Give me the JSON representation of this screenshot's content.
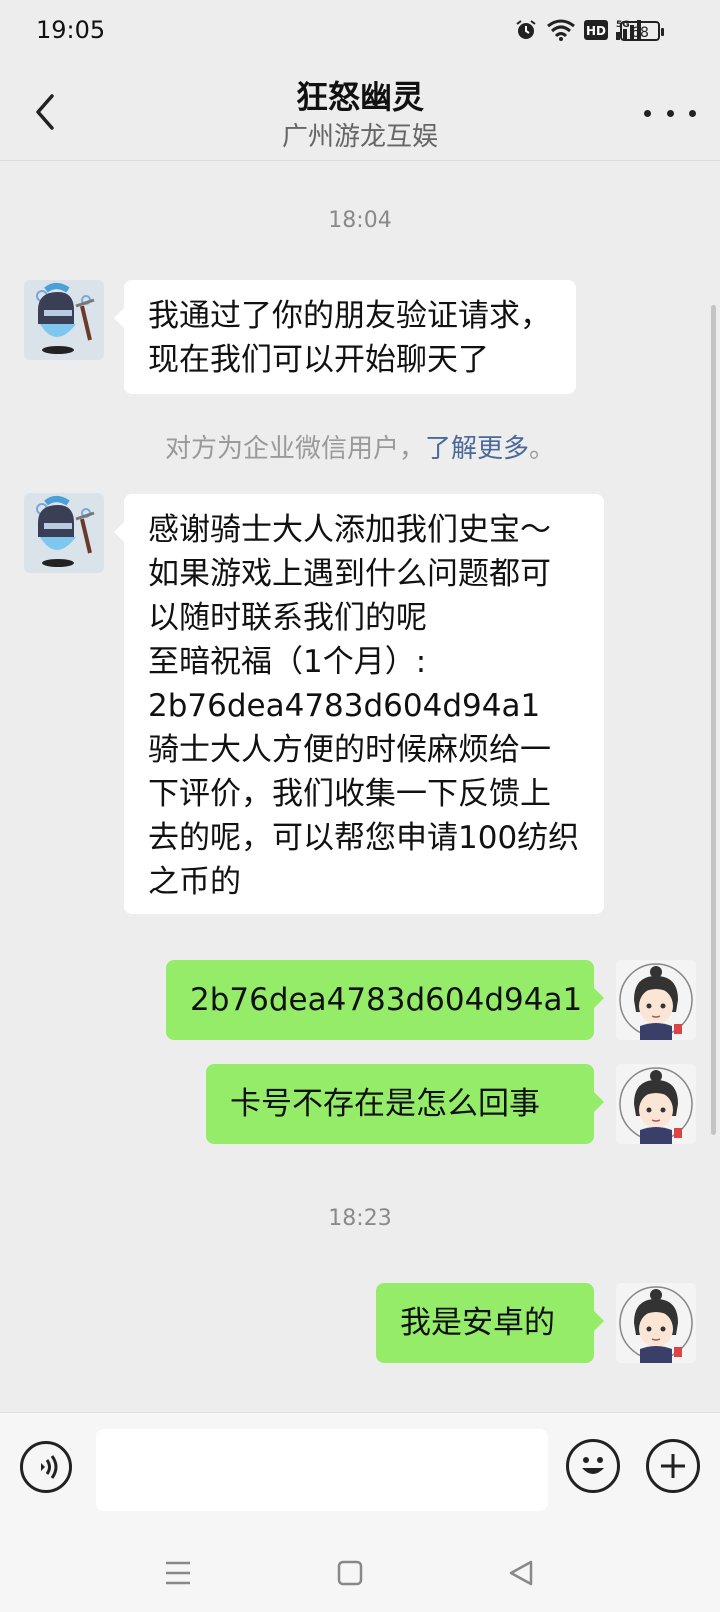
{
  "status_bar": {
    "time": "19:05",
    "battery": "68",
    "icons": [
      "alarm-icon",
      "wifi-icon",
      "hd-icon",
      "signal-5g-icon",
      "battery-icon"
    ]
  },
  "header": {
    "title": "狂怒幽灵",
    "subtitle": "广州游龙互娱",
    "back_icon": "chevron-left-icon",
    "more_icon": "more-icon"
  },
  "messages": {
    "time1": "18:04",
    "m1": "我通过了你的朋友验证请求，\n现在我们可以开始聊天了",
    "notice_text": "对方为企业微信用户，",
    "notice_link": "了解更多",
    "notice_end": "。",
    "m2": "感谢骑士大人添加我们史宝～\n如果游戏上遇到什么问题都可以随时联系我们的呢\n至暗祝福（1个月）:\n2b76dea4783d604d94a1\n骑士大人方便的时候麻烦给一下评价，我们收集一下反馈上去的呢，可以帮您申请100纺织之币的",
    "m3": "2b76dea4783d604d94a1",
    "m4": "卡号不存在是怎么回事",
    "time2": "18:23",
    "m5": "我是安卓的"
  },
  "input_bar": {
    "text_value": "",
    "voice_icon": "voice-icon",
    "emoji_icon": "emoji-icon",
    "plus_icon": "plus-icon"
  },
  "nav_bar": {
    "icons": [
      "menu-icon",
      "home-icon",
      "back-triangle-icon"
    ]
  }
}
